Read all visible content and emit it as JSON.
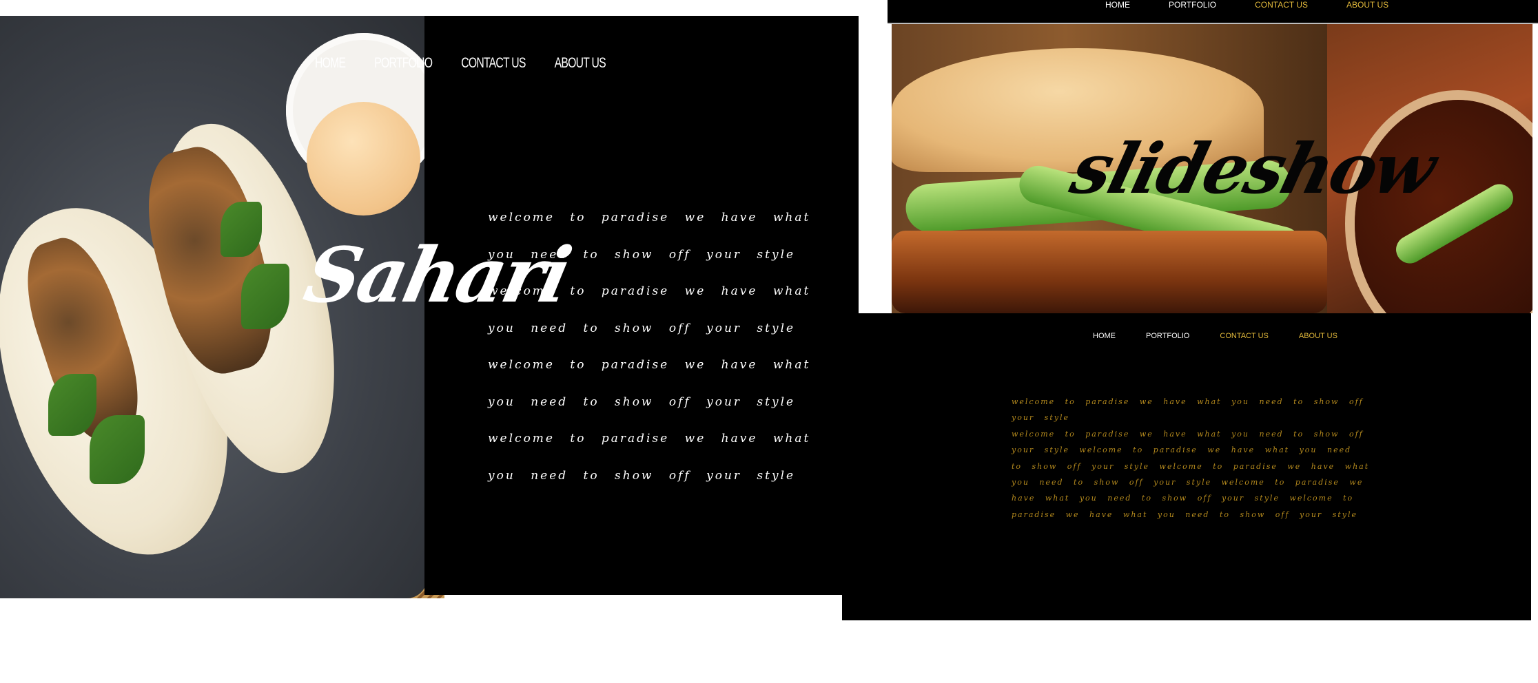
{
  "left_site": {
    "nav": [
      "HOME",
      "PORTFOLIO",
      "CONTACT US",
      "ABOUT US"
    ],
    "brand": "Sahari",
    "body": "welcome to paradise we have what you need to show off your style welcome to paradise we have what you need to show off your style welcome to paradise we have what you need to show off your style welcome to paradise we have what you need to show off your style"
  },
  "right_site": {
    "nav": [
      "HOME",
      "PORTFOLIO",
      "CONTACT US",
      "ABOUT US"
    ],
    "slideshow_title": "slideshow",
    "body_first": "welcome to paradise we have what you need to show off your style",
    "body_second": "welcome to paradise we have what you need to show off your style welcome to paradise we have what you need to show off your style welcome to paradise we have what you need to show off your style welcome to paradise we have what you need to show off your style welcome to paradise we have what you need to show off your style"
  },
  "colors": {
    "panel_bg": "#000000",
    "nav_white": "#ffffff",
    "nav_accent": "#e2b93b",
    "body_gold": "#b58a1d"
  }
}
